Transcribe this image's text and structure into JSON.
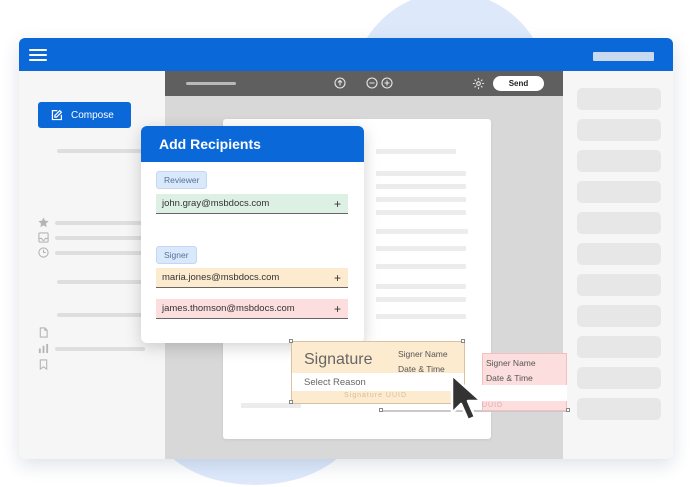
{
  "sidebar": {
    "compose_label": "Compose"
  },
  "toolbar": {
    "send_label": "Send"
  },
  "recipients": {
    "title": "Add Recipients",
    "groups": [
      {
        "role": "Reviewer",
        "emails": [
          "john.gray@msbdocs.com"
        ]
      },
      {
        "role": "Signer",
        "emails": [
          "maria.jones@msbdocs.com",
          "james.thomson@msbdocs.com"
        ]
      }
    ],
    "add_symbol": "+"
  },
  "signature_primary": {
    "title": "Signature",
    "signer_name": "Signer Name",
    "date_time": "Date & Time",
    "reason": "Select Reason",
    "uuid": "Signature UUID"
  },
  "signature_secondary": {
    "signer_name": "Signer Name",
    "date_time": "Date & Time",
    "uuid_fragment": "UUID"
  },
  "colors": {
    "brand": "#0b68d9",
    "reviewer_field": "#ddf0e4",
    "signer_field_1": "#fdebd0",
    "signer_field_2": "#fcdede"
  },
  "icons": [
    "hamburger-icon",
    "compose-icon",
    "star-icon",
    "inbox-icon",
    "clock-icon",
    "file-icon",
    "chart-icon",
    "bookmark-icon",
    "arrow-up-icon",
    "zoom-out-icon",
    "zoom-in-icon",
    "gear-icon",
    "pointer-cursor-icon"
  ]
}
